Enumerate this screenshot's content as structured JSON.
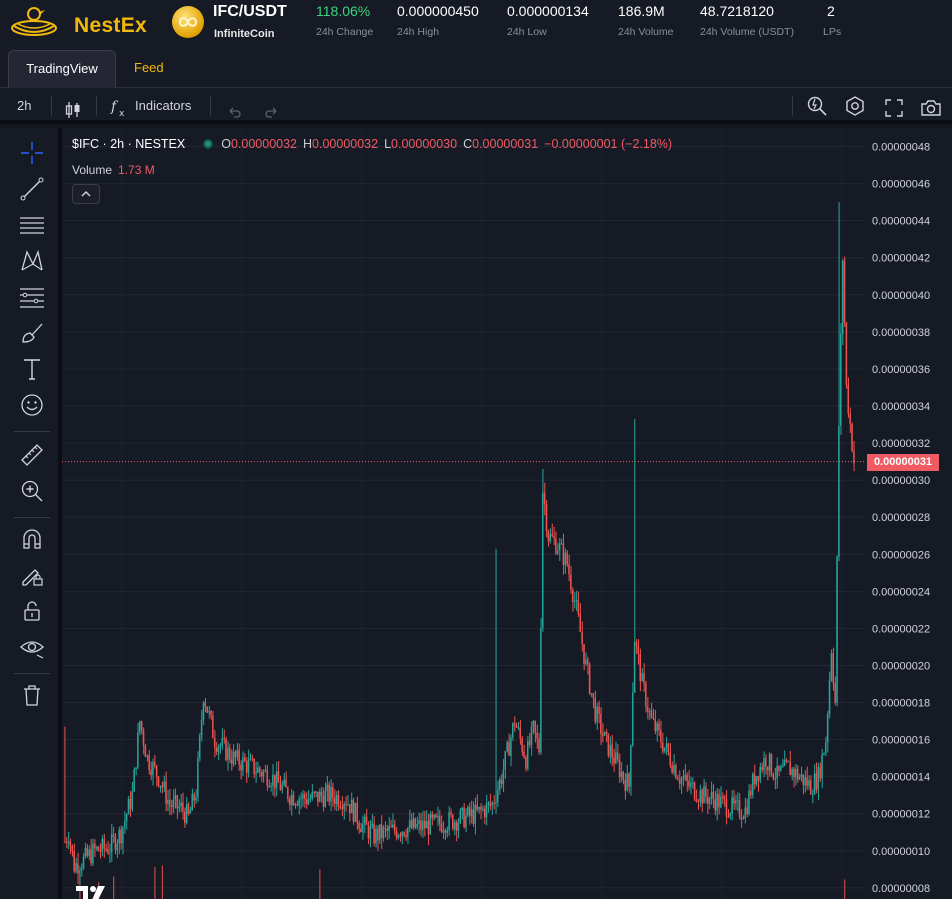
{
  "header": {
    "logo_text": "NestEx",
    "pair": "IFC/USDT",
    "coin_name": "InfiniteCoin",
    "stats": [
      {
        "value": "118.06%",
        "label": "24h Change",
        "positive": true
      },
      {
        "value": "0.000000450",
        "label": "24h High"
      },
      {
        "value": "0.000000134",
        "label": "24h Low"
      },
      {
        "value": "186.9M",
        "label": "24h Volume"
      },
      {
        "value": "48.7218120",
        "label": "24h Volume (USDT)"
      },
      {
        "value": "2",
        "label": "LPs"
      }
    ]
  },
  "tabs": [
    {
      "label": "TradingView",
      "active": true
    },
    {
      "label": "Feed",
      "active": false
    }
  ],
  "toolbar": {
    "interval": "2h",
    "indicators_label": "Indicators",
    "left_icons": [
      "candles-icon",
      "indicators-fx-icon",
      "undo-icon",
      "redo-icon"
    ],
    "right_icons": [
      "quick-search-icon",
      "settings-icon",
      "fullscreen-icon",
      "screenshot-icon"
    ]
  },
  "drawing_tools": [
    "crosshair-icon",
    "trend-line-icon",
    "horizontal-lines-icon",
    "pattern-icon",
    "fib-retracement-icon",
    "brush-icon",
    "text-icon",
    "emoji-icon",
    "ruler-icon",
    "zoom-in-icon",
    "magnet-icon",
    "lock-drawing-icon",
    "unlock-icon",
    "eye-icon",
    "trash-icon"
  ],
  "legend": {
    "symbol": "$IFC · 2h · NESTEX",
    "open_label": "O",
    "open": "0.00000032",
    "high_label": "H",
    "high": "0.00000032",
    "low_label": "L",
    "low": "0.00000030",
    "close_label": "C",
    "close": "0.00000031",
    "change": "−0.00000001 (−2.18%)",
    "volume_label": "Volume",
    "volume": "1.73 M"
  },
  "colors": {
    "up": "#26a69a",
    "down": "#ef5350",
    "accent": "#f0b90b",
    "price_line": "#f05a62"
  },
  "chart_data": {
    "type": "candlestick",
    "interval": "2h",
    "symbol": "$IFC",
    "exchange": "NESTEX",
    "current_price": "0.00000031",
    "y_ticks": [
      "0.00000048",
      "0.00000046",
      "0.00000044",
      "0.00000042",
      "0.00000040",
      "0.00000038",
      "0.00000036",
      "0.00000034",
      "0.00000032",
      "0.00000030",
      "0.00000028",
      "0.00000026",
      "0.00000024",
      "0.00000022",
      "0.00000020",
      "0.00000018",
      "0.00000016",
      "0.00000014",
      "0.00000012",
      "0.00000010",
      "0.00000008"
    ],
    "ylim": [
      7.4e-08,
      4.9e-07
    ],
    "grid": true,
    "anchors": [
      [
        0,
        0.105
      ],
      [
        2,
        0.11
      ],
      [
        5,
        0.092
      ],
      [
        10,
        0.095
      ],
      [
        16,
        0.1
      ],
      [
        24,
        0.102
      ],
      [
        30,
        0.11
      ],
      [
        36,
        0.13
      ],
      [
        40,
        0.17
      ],
      [
        44,
        0.15
      ],
      [
        50,
        0.14
      ],
      [
        56,
        0.125
      ],
      [
        62,
        0.123
      ],
      [
        66,
        0.118
      ],
      [
        70,
        0.132
      ],
      [
        74,
        0.185
      ],
      [
        80,
        0.16
      ],
      [
        90,
        0.15
      ],
      [
        100,
        0.145
      ],
      [
        110,
        0.14
      ],
      [
        120,
        0.13
      ],
      [
        130,
        0.128
      ],
      [
        140,
        0.13
      ],
      [
        150,
        0.128
      ],
      [
        158,
        0.115
      ],
      [
        165,
        0.108
      ],
      [
        172,
        0.11
      ],
      [
        180,
        0.112
      ],
      [
        190,
        0.113
      ],
      [
        200,
        0.115
      ],
      [
        210,
        0.117
      ],
      [
        220,
        0.12
      ],
      [
        228,
        0.125
      ],
      [
        233,
        0.14
      ],
      [
        240,
        0.17
      ],
      [
        246,
        0.15
      ],
      [
        250,
        0.165
      ],
      [
        253,
        0.155
      ],
      [
        255,
        0.295
      ],
      [
        258,
        0.27
      ],
      [
        263,
        0.265
      ],
      [
        268,
        0.255
      ],
      [
        273,
        0.23
      ],
      [
        278,
        0.2
      ],
      [
        283,
        0.175
      ],
      [
        288,
        0.16
      ],
      [
        293,
        0.15
      ],
      [
        298,
        0.14
      ],
      [
        301,
        0.135
      ],
      [
        304,
        0.215
      ],
      [
        308,
        0.19
      ],
      [
        313,
        0.17
      ],
      [
        318,
        0.16
      ],
      [
        323,
        0.15
      ],
      [
        328,
        0.14
      ],
      [
        333,
        0.135
      ],
      [
        340,
        0.13
      ],
      [
        346,
        0.128
      ],
      [
        352,
        0.125
      ],
      [
        358,
        0.122
      ],
      [
        363,
        0.122
      ],
      [
        368,
        0.14
      ],
      [
        374,
        0.15
      ],
      [
        380,
        0.14
      ],
      [
        386,
        0.145
      ],
      [
        392,
        0.14
      ],
      [
        398,
        0.135
      ],
      [
        402,
        0.14
      ],
      [
        406,
        0.16
      ],
      [
        409,
        0.21
      ],
      [
        411,
        0.18
      ],
      [
        413,
        0.33
      ],
      [
        415,
        0.42
      ],
      [
        417,
        0.35
      ],
      [
        419,
        0.33
      ],
      [
        421,
        0.31
      ]
    ],
    "wick_spikes": [
      {
        "i": 0,
        "high": 0.167
      },
      {
        "i": 230,
        "high": 0.263
      },
      {
        "i": 255,
        "high": 0.306
      },
      {
        "i": 304,
        "high": 0.333
      },
      {
        "i": 413,
        "high": 0.45
      }
    ],
    "volume_bars": [
      {
        "i": 8,
        "value": 1.9
      },
      {
        "i": 18,
        "value": 1.2
      },
      {
        "i": 26,
        "value": 1.6
      },
      {
        "i": 48,
        "value": 2.3
      },
      {
        "i": 52,
        "value": 2.4
      },
      {
        "i": 136,
        "value": 2.1
      },
      {
        "i": 416,
        "value": 1.4
      }
    ]
  }
}
